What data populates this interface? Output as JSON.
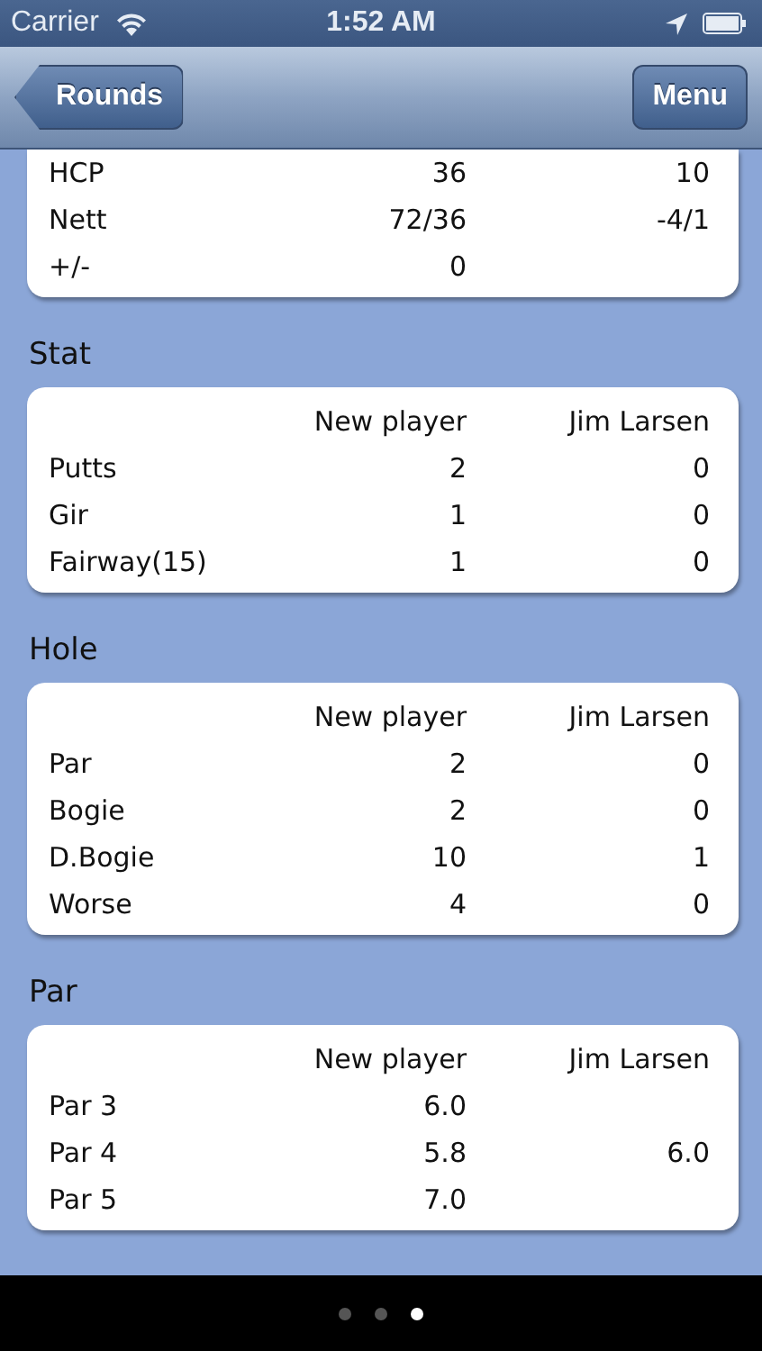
{
  "status_bar": {
    "carrier": "Carrier",
    "time": "1:52 AM"
  },
  "nav_bar": {
    "back_button": "Rounds",
    "menu_button": "Menu"
  },
  "sections": [
    {
      "rows": [
        {
          "label": "HCP",
          "value_1": "36",
          "value_2": "10"
        },
        {
          "label": "Nett",
          "value_1": "72/36",
          "value_2": "-4/1"
        },
        {
          "label": "+/-",
          "value_1": "0"
        }
      ]
    },
    {
      "title": "Stat",
      "columns": [
        "New player",
        "Jim Larsen"
      ],
      "rows": [
        {
          "label": "Putts",
          "value_1": "2",
          "value_2": "0"
        },
        {
          "label": "Gir",
          "value_1": "1",
          "value_2": "0"
        },
        {
          "label": "Fairway(15)",
          "value_1": "1",
          "value_2": "0"
        }
      ]
    },
    {
      "title": "Hole",
      "columns": [
        "New player",
        "Jim Larsen"
      ],
      "rows": [
        {
          "label": "Par",
          "value_1": "2",
          "value_2": "0"
        },
        {
          "label": "Bogie",
          "value_1": "2",
          "value_2": "0"
        },
        {
          "label": "D.Bogie",
          "value_1": "10",
          "value_2": "1"
        },
        {
          "label": "Worse",
          "value_1": "4",
          "value_2": "0"
        }
      ]
    },
    {
      "title": "Par",
      "columns": [
        "New player",
        "Jim Larsen"
      ],
      "rows": [
        {
          "label": "Par 3",
          "value_1": "6.0"
        },
        {
          "label": "Par 4",
          "value_1": "5.8",
          "value_2": "6.0"
        },
        {
          "label": "Par 5",
          "value_1": "7.0"
        }
      ]
    }
  ],
  "pages": [
    {
      "selected": false
    },
    {
      "selected": false
    },
    {
      "selected": true
    }
  ]
}
